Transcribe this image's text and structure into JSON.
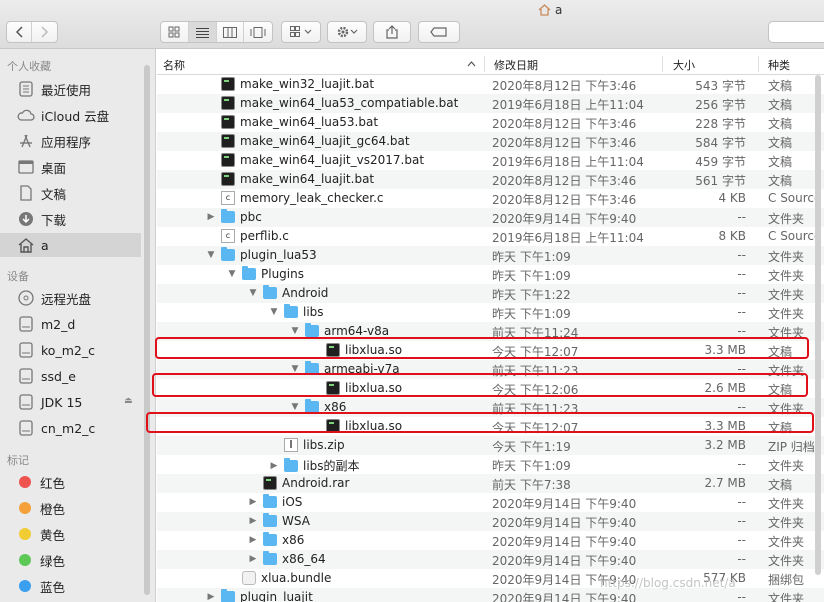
{
  "window": {
    "title": "a"
  },
  "sidebar": {
    "favorites_label": "个人收藏",
    "devices_label": "设备",
    "tags_label": "标记",
    "favorites": [
      {
        "label": "最近使用",
        "icon": "recents-icon"
      },
      {
        "label": "iCloud 云盘",
        "icon": "icloud-icon"
      },
      {
        "label": "应用程序",
        "icon": "applications-icon"
      },
      {
        "label": "桌面",
        "icon": "desktop-icon"
      },
      {
        "label": "文稿",
        "icon": "documents-icon"
      },
      {
        "label": "下载",
        "icon": "downloads-icon"
      },
      {
        "label": "a",
        "icon": "home-icon"
      }
    ],
    "devices": [
      {
        "label": "远程光盘",
        "icon": "remote-disc-icon"
      },
      {
        "label": "m2_d",
        "icon": "drive-icon"
      },
      {
        "label": "ko_m2_c",
        "icon": "drive-icon"
      },
      {
        "label": "ssd_e",
        "icon": "drive-icon"
      },
      {
        "label": "JDK 15",
        "icon": "drive-icon"
      },
      {
        "label": "cn_m2_c",
        "icon": "drive-icon"
      }
    ],
    "tags": [
      {
        "label": "红色",
        "color": "#ef5350"
      },
      {
        "label": "橙色",
        "color": "#f5a03b"
      },
      {
        "label": "黄色",
        "color": "#f1cc33"
      },
      {
        "label": "绿色",
        "color": "#5ec856"
      },
      {
        "label": "蓝色",
        "color": "#3b9ff0"
      }
    ]
  },
  "columns": {
    "name": "名称",
    "date": "修改日期",
    "size": "大小",
    "kind": "种类"
  },
  "files": [
    {
      "name": "make_win32_luajit.bat",
      "date": "2020年8月12日 下午3:46",
      "size": "543 字节",
      "kind": "文稿",
      "type": "term",
      "level": 0,
      "disc": ""
    },
    {
      "name": "make_win64_lua53_compatiable.bat",
      "date": "2019年6月18日 上午11:04",
      "size": "256 字节",
      "kind": "文稿",
      "type": "term",
      "level": 0,
      "disc": ""
    },
    {
      "name": "make_win64_lua53.bat",
      "date": "2020年8月12日 下午3:46",
      "size": "228 字节",
      "kind": "文稿",
      "type": "term",
      "level": 0,
      "disc": ""
    },
    {
      "name": "make_win64_luajit_gc64.bat",
      "date": "2020年8月12日 下午3:46",
      "size": "584 字节",
      "kind": "文稿",
      "type": "term",
      "level": 0,
      "disc": ""
    },
    {
      "name": "make_win64_luajit_vs2017.bat",
      "date": "2019年6月18日 上午11:04",
      "size": "459 字节",
      "kind": "文稿",
      "type": "term",
      "level": 0,
      "disc": ""
    },
    {
      "name": "make_win64_luajit.bat",
      "date": "2020年8月12日 下午3:46",
      "size": "561 字节",
      "kind": "文稿",
      "type": "term",
      "level": 0,
      "disc": ""
    },
    {
      "name": "memory_leak_checker.c",
      "date": "2020年8月12日 下午3:46",
      "size": "4 KB",
      "kind": "C Source",
      "type": "c",
      "level": 0,
      "disc": ""
    },
    {
      "name": "pbc",
      "date": "2020年9月14日 下午9:40",
      "size": "--",
      "kind": "文件夹",
      "type": "folder",
      "level": 0,
      "disc": "▶"
    },
    {
      "name": "perflib.c",
      "date": "2019年6月18日 上午11:04",
      "size": "8 KB",
      "kind": "C Source",
      "type": "c",
      "level": 0,
      "disc": ""
    },
    {
      "name": "plugin_lua53",
      "date": "昨天 下午1:09",
      "size": "--",
      "kind": "文件夹",
      "type": "folder",
      "level": 0,
      "disc": "▼"
    },
    {
      "name": "Plugins",
      "date": "昨天 下午1:09",
      "size": "--",
      "kind": "文件夹",
      "type": "folder",
      "level": 1,
      "disc": "▼"
    },
    {
      "name": "Android",
      "date": "昨天 下午1:22",
      "size": "--",
      "kind": "文件夹",
      "type": "folder",
      "level": 2,
      "disc": "▼"
    },
    {
      "name": "libs",
      "date": "昨天 下午1:09",
      "size": "--",
      "kind": "文件夹",
      "type": "folder",
      "level": 3,
      "disc": "▼"
    },
    {
      "name": "arm64-v8a",
      "date": "前天 下午11:24",
      "size": "--",
      "kind": "文件夹",
      "type": "folder",
      "level": 4,
      "disc": "▼"
    },
    {
      "name": "libxlua.so",
      "date": "今天 下午12:07",
      "size": "3.3 MB",
      "kind": "文稿",
      "type": "term",
      "level": 5,
      "disc": ""
    },
    {
      "name": "armeabi-v7a",
      "date": "前天 下午11:23",
      "size": "--",
      "kind": "文件夹",
      "type": "folder",
      "level": 4,
      "disc": "▼"
    },
    {
      "name": "libxlua.so",
      "date": "今天 下午12:06",
      "size": "2.6 MB",
      "kind": "文稿",
      "type": "term",
      "level": 5,
      "disc": ""
    },
    {
      "name": "x86",
      "date": "前天 下午11:23",
      "size": "--",
      "kind": "文件夹",
      "type": "folder",
      "level": 4,
      "disc": "▼"
    },
    {
      "name": "libxlua.so",
      "date": "今天 下午12:07",
      "size": "3.3 MB",
      "kind": "文稿",
      "type": "term",
      "level": 5,
      "disc": ""
    },
    {
      "name": "libs.zip",
      "date": "今天 下午1:19",
      "size": "3.2 MB",
      "kind": "ZIP 归档",
      "type": "zip",
      "level": 3,
      "disc": ""
    },
    {
      "name": "libs的副本",
      "date": "昨天 下午1:09",
      "size": "--",
      "kind": "文件夹",
      "type": "folder",
      "level": 3,
      "disc": "▶"
    },
    {
      "name": "Android.rar",
      "date": "前天 下午7:38",
      "size": "2.7 MB",
      "kind": "文稿",
      "type": "term",
      "level": 2,
      "disc": ""
    },
    {
      "name": "iOS",
      "date": "2020年9月14日 下午9:40",
      "size": "--",
      "kind": "文件夹",
      "type": "folder",
      "level": 2,
      "disc": "▶"
    },
    {
      "name": "WSA",
      "date": "2020年9月14日 下午9:40",
      "size": "--",
      "kind": "文件夹",
      "type": "folder",
      "level": 2,
      "disc": "▶"
    },
    {
      "name": "x86",
      "date": "2020年9月14日 下午9:40",
      "size": "--",
      "kind": "文件夹",
      "type": "folder",
      "level": 2,
      "disc": "▶"
    },
    {
      "name": "x86_64",
      "date": "2020年9月14日 下午9:40",
      "size": "--",
      "kind": "文件夹",
      "type": "folder",
      "level": 2,
      "disc": "▶"
    },
    {
      "name": "xlua.bundle",
      "date": "2020年9月14日 下午9:40",
      "size": "577 KB",
      "kind": "捆绑包",
      "type": "bundle",
      "level": 1,
      "disc": ""
    },
    {
      "name": "plugin_luajit",
      "date": "2020年9月14日 下午9:40",
      "size": "--",
      "kind": "文件夹",
      "type": "folder",
      "level": 0,
      "disc": "▶"
    }
  ],
  "highlight_color": "#e0101a",
  "watermark": "https://blog.csdn.net/a"
}
